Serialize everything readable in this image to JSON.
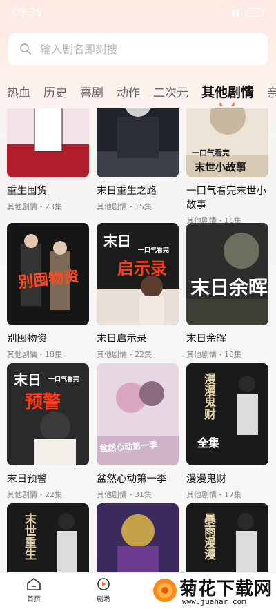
{
  "status": {
    "time": "09:39",
    "battery": "(100)"
  },
  "search": {
    "placeholder": "输入剧名即刻搜"
  },
  "tabs": [
    "热血",
    "历史",
    "喜剧",
    "动作",
    "二次元",
    "其他剧情",
    "亲情"
  ],
  "active_tab": "其他剧情",
  "dramas": [
    {
      "title": "重生囤货",
      "meta": "其他剧情・23集",
      "cover_text": ""
    },
    {
      "title": "末日重生之路",
      "meta": "其他剧情・15集",
      "cover_text": ""
    },
    {
      "title": "一口气看完末世小故事",
      "meta": "其他剧情・16集",
      "cover_text": "末世小故事"
    },
    {
      "title": "别囤物资",
      "meta": "其他剧情・18集",
      "cover_text": "别囤物资"
    },
    {
      "title": "末日启示录",
      "meta": "其他剧情・22集",
      "cover_text": "启示录"
    },
    {
      "title": "末日余晖",
      "meta": "其他剧情・18集",
      "cover_text": "末日余晖"
    },
    {
      "title": "末日预警",
      "meta": "其他剧情・22集",
      "cover_text": "预警"
    },
    {
      "title": "盆然心动第一季",
      "meta": "其他剧情・31集",
      "cover_text": "盆然心动第一季"
    },
    {
      "title": "漫漫鬼财",
      "meta": "其他剧情・17集",
      "cover_text": "漫漫鬼财"
    },
    {
      "title": "",
      "meta": "",
      "cover_text": "末世重生"
    },
    {
      "title": "",
      "meta": "",
      "cover_text": ""
    },
    {
      "title": "",
      "meta": "",
      "cover_text": "暴雨漫漫"
    }
  ],
  "cover_extras": {
    "c2_top": "一口气看完",
    "c4_top": "末日",
    "c4_sub": "一口气看完",
    "c6_top": "末日",
    "c6_sub": "一口气看完",
    "c7_sub": "全集"
  },
  "nav": [
    {
      "label": "首页",
      "icon": "home-icon"
    },
    {
      "label": "剧场",
      "icon": "theater-icon"
    }
  ],
  "watermark": {
    "title": "菊花下载网",
    "url": "www.juahar.com"
  },
  "colors": {
    "accent": "#ff6a2a"
  }
}
